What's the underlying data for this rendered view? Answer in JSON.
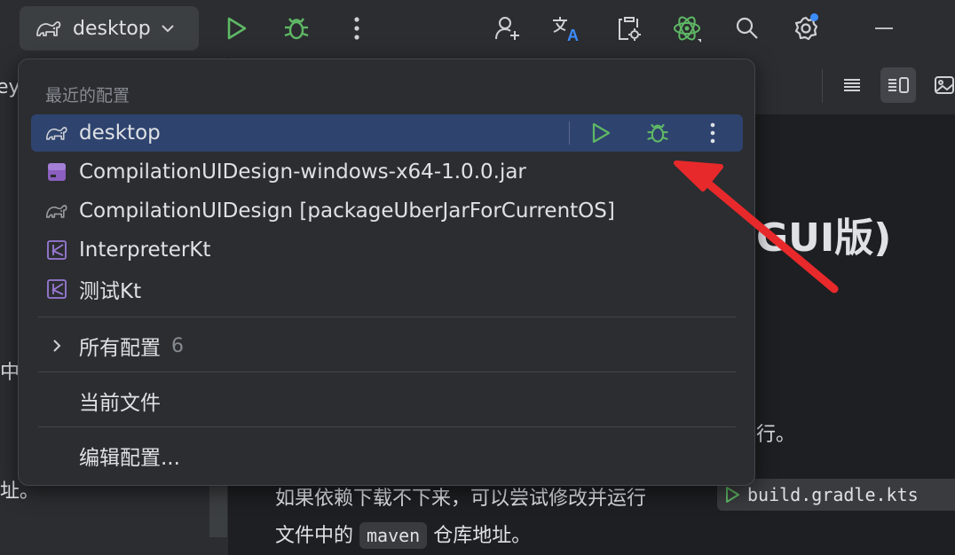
{
  "toolbar": {
    "config_label": "desktop",
    "icons": [
      "run-icon",
      "debug-icon",
      "more-vertical-icon",
      "add-user-icon",
      "translate-icon",
      "clipboard-settings-icon",
      "atom-plugin-icon",
      "search-icon",
      "settings-icon",
      "minimize-icon"
    ],
    "colors": {
      "run": "#5fb865",
      "debug": "#5fb865",
      "notification_dot": "#3d8cff"
    }
  },
  "background": {
    "left_fragments": [
      "ey",
      "中",
      "址。"
    ],
    "heading_fragment": "GUI版)",
    "line_fragment": "行。",
    "paragraph_line1": "如果依赖下载不下来，可以尝试修改并运行",
    "build_file": "build.gradle.kts",
    "paragraph_line2_prefix": "文件中的",
    "maven_code": "maven",
    "paragraph_line2_suffix": "仓库地址。"
  },
  "popup": {
    "section_title": "最近的配置",
    "recent": [
      {
        "label": "desktop",
        "icon": "gradle-elephant-icon",
        "selected": true
      },
      {
        "label": "CompilationUIDesign-windows-x64-1.0.0.jar",
        "icon": "jar-file-icon"
      },
      {
        "label": "CompilationUIDesign [packageUberJarForCurrentOS]",
        "icon": "gradle-elephant-icon"
      },
      {
        "label": "InterpreterKt",
        "icon": "kotlin-icon"
      },
      {
        "label": "测试Kt",
        "icon": "kotlin-icon"
      }
    ],
    "all_configs": {
      "label": "所有配置",
      "count": "6"
    },
    "current_file": "当前文件",
    "edit_configs": "编辑配置..."
  },
  "annotation": {
    "color": "#e8292b"
  }
}
